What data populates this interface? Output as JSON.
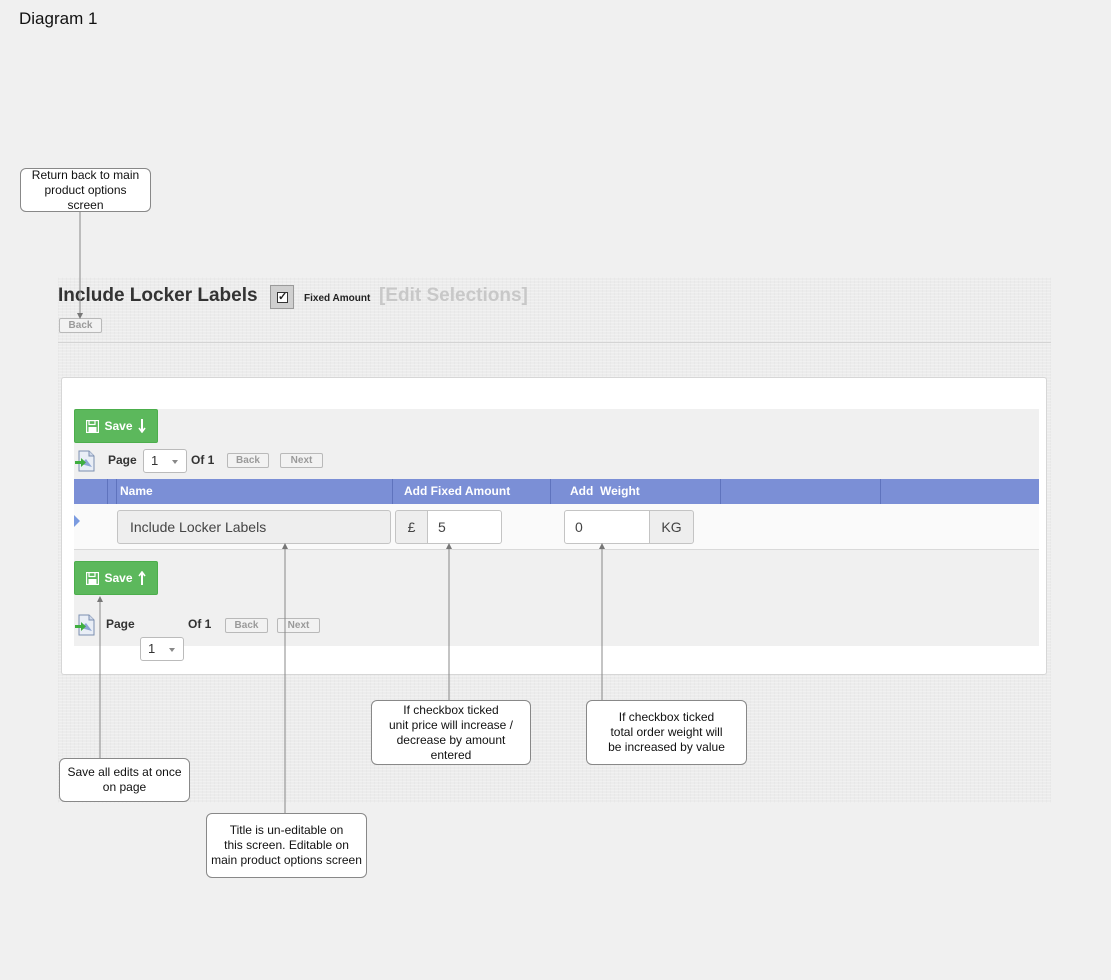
{
  "diagram": {
    "title": "Diagram 1"
  },
  "header": {
    "title": "Include Locker Labels",
    "fixed_amount_checked": true,
    "fixed_amount_label": "Fixed Amount",
    "edit_selections_label": "[Edit Selections]",
    "back_label": "Back"
  },
  "toolbar_top": {
    "save_label": "Save",
    "page_label": "Page",
    "page_value": "1",
    "of_label": "Of 1",
    "back_label": "Back",
    "next_label": "Next"
  },
  "grid": {
    "columns": [
      "Name",
      "Add Fixed Amount",
      "Add  Weight"
    ],
    "rows": [
      {
        "name": "Include Locker Labels",
        "currency": "£",
        "fixed_amount": "5",
        "weight": "0",
        "weight_unit": "KG"
      }
    ]
  },
  "toolbar_bottom": {
    "save_label": "Save",
    "page_label": "Page",
    "page_value": "1",
    "of_label": "Of 1",
    "back_label": "Back",
    "next_label": "Next"
  },
  "callouts": {
    "back": [
      "Return back to main",
      "product options screen"
    ],
    "save": [
      "Save all edits at once",
      "on page"
    ],
    "title": [
      "Title is un-editable on",
      "this screen. Editable on",
      "main product options screen"
    ],
    "fixed_amount": [
      "If checkbox ticked",
      "unit price will increase /",
      "decrease by amount entered"
    ],
    "weight": [
      "If checkbox ticked",
      "total order weight will",
      "be increased by value"
    ]
  },
  "colors": {
    "save_green": "#5cb85c",
    "grid_header_blue": "#7b8fd6"
  }
}
